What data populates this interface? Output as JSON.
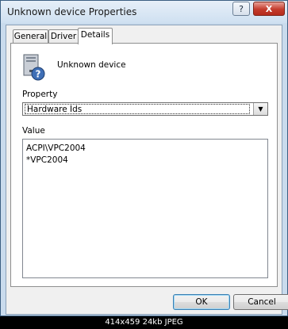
{
  "window": {
    "title": "Unknown device Properties",
    "help_label": "?",
    "close_label": "X"
  },
  "tabs": [
    {
      "label": "General"
    },
    {
      "label": "Driver"
    },
    {
      "label": "Details"
    }
  ],
  "details": {
    "device_name": "Unknown device",
    "property_label": "Property",
    "property_value": "Hardware Ids",
    "value_label": "Value",
    "values": [
      "ACPI\\VPC2004",
      "*VPC2004"
    ]
  },
  "buttons": {
    "ok": "OK",
    "cancel": "Cancel"
  },
  "footer": "414x459  24kb  JPEG"
}
